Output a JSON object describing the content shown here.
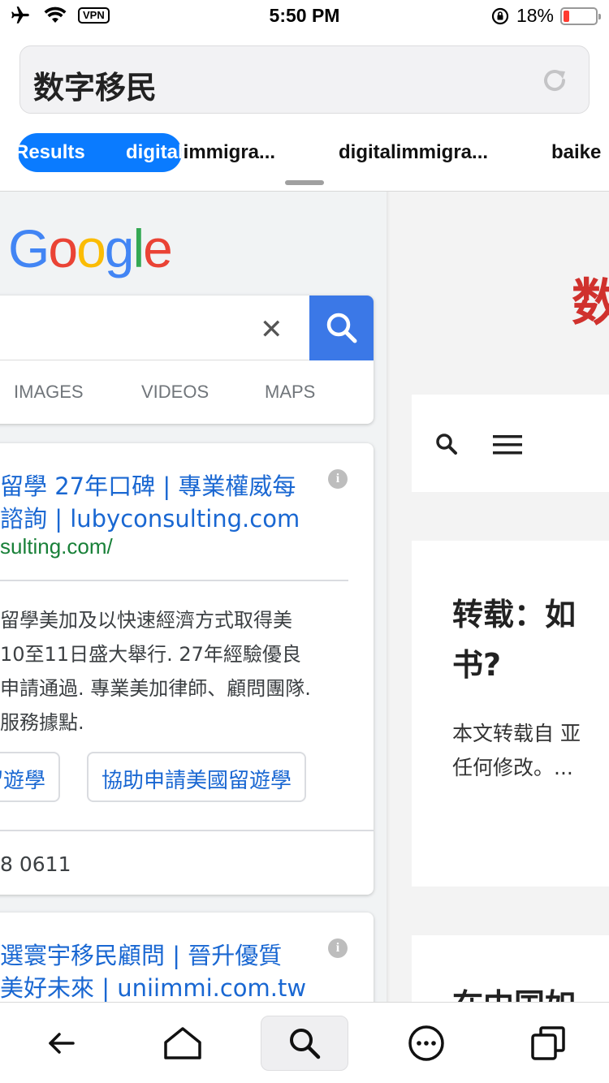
{
  "status_bar": {
    "time": "5:50 PM",
    "vpn_label": "VPN",
    "battery_percent": "18%",
    "battery_level": 0.18,
    "battery_color": "#ff3b30"
  },
  "search": {
    "query": "数字移民",
    "reload_icon": "reload-icon"
  },
  "tabs": [
    {
      "label": "Results",
      "active": true
    },
    {
      "label": "digitalimmigra...",
      "active": true
    },
    {
      "label": "digitalimmigra...",
      "active": false
    },
    {
      "label": "digitalimmigra...",
      "active": false
    },
    {
      "label": "baike",
      "active": false
    }
  ],
  "google": {
    "logo_letters": [
      {
        "ch": "G",
        "color": "#4285f4"
      },
      {
        "ch": "o",
        "color": "#ea4335"
      },
      {
        "ch": "o",
        "color": "#fbbc05"
      },
      {
        "ch": "g",
        "color": "#4285f4"
      },
      {
        "ch": "l",
        "color": "#34a853"
      },
      {
        "ch": "e",
        "color": "#ea4335"
      }
    ],
    "clear_glyph": "✕",
    "nav_tabs": [
      "IMAGES",
      "VIDEOS",
      "MAPS"
    ],
    "accent": "#3b78e7"
  },
  "results": [
    {
      "title_lines": [
        "留學 27年口碑 | 專業權威每",
        "諮詢 | lubyconsulting.com"
      ],
      "url": "sulting.com/",
      "snippet_lines": [
        "留學美加及以快速經濟方式取得美",
        "10至11日盛大舉行. 27年經驗優良",
        "申請通過. 專業美加律師、顧問團隊.",
        "服務據點."
      ],
      "chips": [
        "留遊學",
        "協助申請美國留遊學"
      ],
      "phone": "8 0611",
      "info": "i"
    },
    {
      "title_lines": [
        "選寰宇移民顧問 | 晉升優質",
        "美好未來 | uniimmi.com.tw"
      ],
      "info": "i"
    }
  ],
  "right_pane": {
    "big_char": "数",
    "brand_color": "#d0312d",
    "article_title_lines": [
      "转载：如",
      "书?"
    ],
    "article_text_lines": [
      "本文转载自 亚",
      "任何修改。..."
    ],
    "next_title": "在中国如"
  },
  "toolbar": {
    "buttons": [
      "back-arrow-icon",
      "home-icon",
      "search-icon",
      "more-icon",
      "tabs-icon"
    ],
    "active_index": 2
  }
}
